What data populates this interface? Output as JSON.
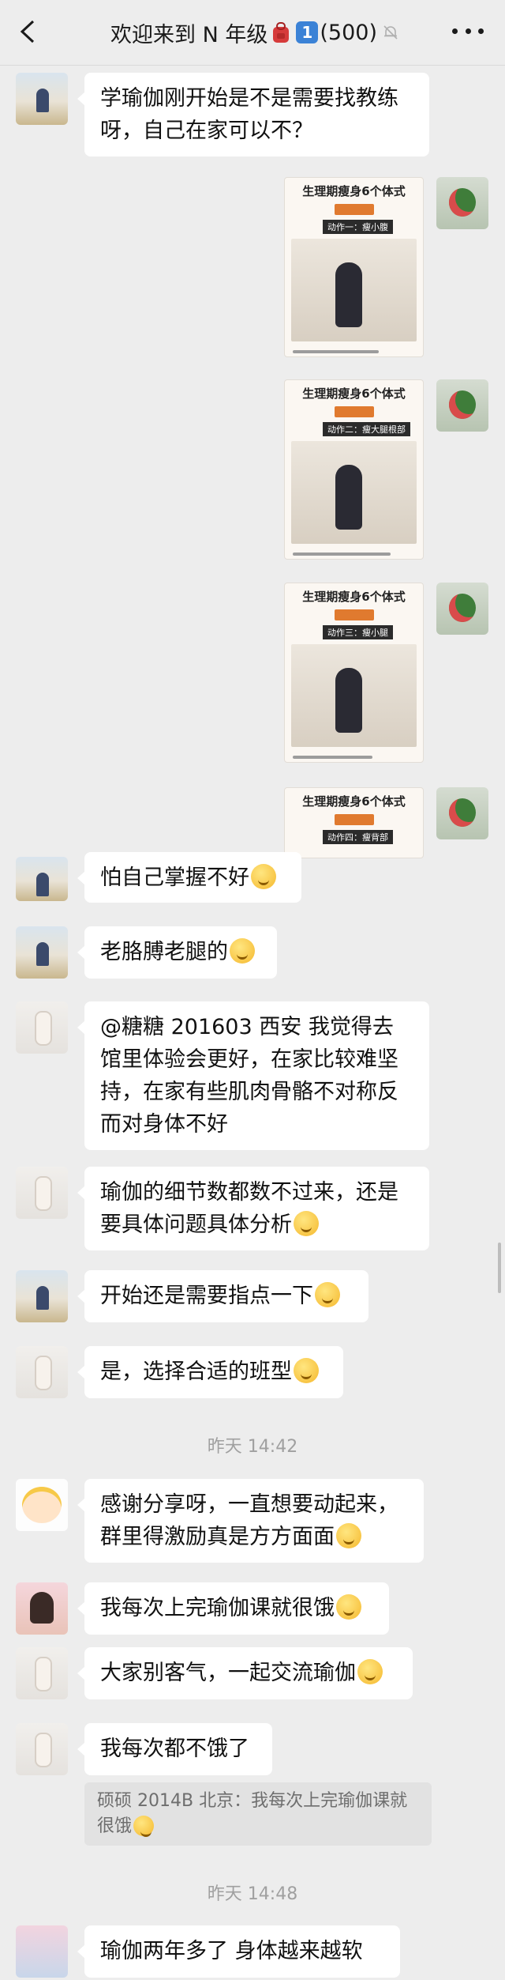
{
  "header": {
    "title_prefix": "欢迎来到 N 年级",
    "badge_number": "1",
    "member_count": "(500)",
    "icons": [
      "back-icon",
      "backpack-icon",
      "mute-bell-icon",
      "more-icon"
    ]
  },
  "messages": [
    {
      "text": "学瑜伽刚开始是不是需要找教练呀，自己在家可以不？"
    },
    {
      "text": "怕自己掌握不好",
      "emoji": "smirk-emoji"
    },
    {
      "text": "老胳膊老腿的",
      "emoji": "laugh-cry-emoji"
    },
    {
      "text": "@糖糖 201603 西安 我觉得去馆里体验会更好，在家比较难坚持，在家有些肌肉骨骼不对称反而对身体不好"
    },
    {
      "text": "瑜伽的细节数都数不过来，还是要具体问题具体分析",
      "emoji": "smile-emoji"
    },
    {
      "text": "开始还是需要指点一下",
      "emoji": "smirk-emoji"
    },
    {
      "text": "是，选择合适的班型",
      "emoji": "smile-emoji"
    },
    {
      "text": "感谢分享呀，一直想要动起来，群里得激励真是方方面面",
      "emoji": "smirk-emoji"
    },
    {
      "text": "我每次上完瑜伽课就很饿",
      "emoji": "laugh-cry-emoji"
    },
    {
      "text": "大家别客气，一起交流瑜伽",
      "emoji": "smile-emoji"
    },
    {
      "text": "我每次都不饿了"
    },
    {
      "text": "瑜伽两年多了 身体越来越软"
    }
  ],
  "images": [
    {
      "title": "生理期瘦身6个体式",
      "subtitle": "动作一：瘦小腹"
    },
    {
      "title": "生理期瘦身6个体式",
      "subtitle": "动作二：瘦大腿根部"
    },
    {
      "title": "生理期瘦身6个体式",
      "subtitle": "动作三：瘦小腿"
    },
    {
      "title": "生理期瘦身6个体式",
      "subtitle": "动作四：瘦背部"
    }
  ],
  "quote": {
    "text": "硕硕 2014B 北京：我每次上完瑜伽课就很饿",
    "emoji": "laugh-cry-emoji"
  },
  "timestamps": [
    "昨天 14:42",
    "昨天 14:48"
  ]
}
